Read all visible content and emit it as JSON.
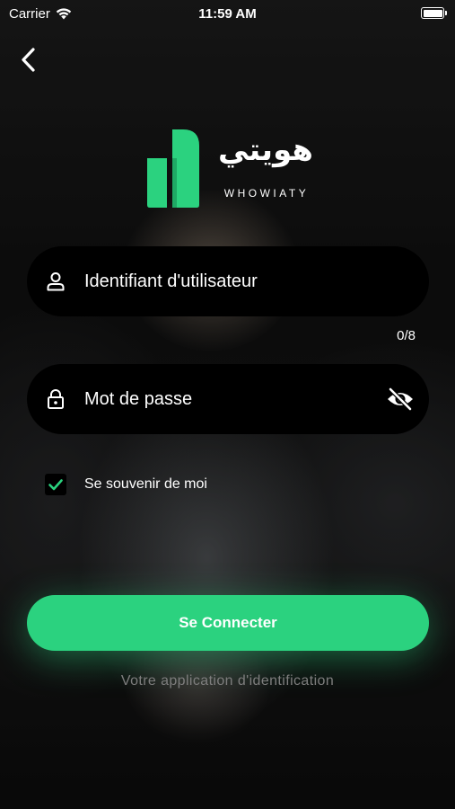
{
  "status_bar": {
    "carrier": "Carrier",
    "time": "11:59 AM"
  },
  "logo": {
    "arabic_name": "هويتي",
    "latin_name": "WHOWIATY",
    "brand_color": "#2bd27f"
  },
  "login_form": {
    "username_placeholder": "Identifiant d'utilisateur",
    "username_counter": "0/8",
    "password_placeholder": "Mot de passe",
    "remember_label": "Se souvenir de moi",
    "remember_checked": true,
    "submit_label": "Se Connecter"
  },
  "tagline": "Votre application d'identification",
  "icons": {
    "back": "chevron-left-icon",
    "user": "user-icon",
    "lock": "lock-icon",
    "visibility": "eye-off-icon",
    "check": "check-icon"
  },
  "colors": {
    "accent": "#2bd27f",
    "field_background": "#000000",
    "text": "#ffffff",
    "tagline": "#7d7d7d"
  }
}
